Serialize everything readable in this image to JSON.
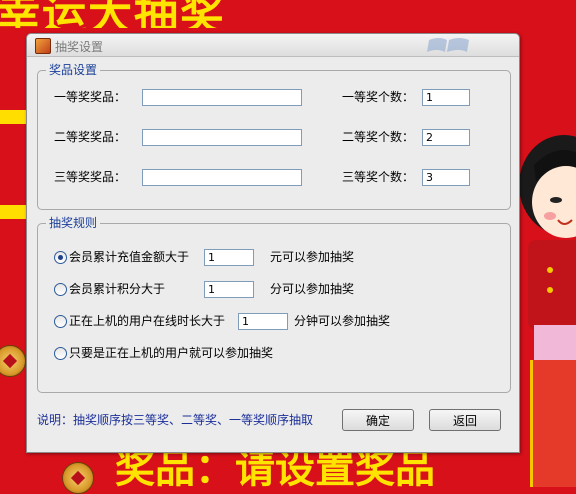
{
  "background": {
    "top_banner_text": "幸运大抽奖",
    "bottom_banner_text": "奖品：请设置奖品"
  },
  "dialog": {
    "title": "抽奖设置",
    "prizes_group": {
      "title": "奖品设置",
      "rows": [
        {
          "prize_label": "一等奖奖品：",
          "prize_value": "",
          "count_label": "一等奖个数：",
          "count_value": "1"
        },
        {
          "prize_label": "二等奖奖品：",
          "prize_value": "",
          "count_label": "二等奖个数：",
          "count_value": "2"
        },
        {
          "prize_label": "三等奖奖品：",
          "prize_value": "",
          "count_label": "三等奖个数：",
          "count_value": "3"
        }
      ]
    },
    "rules_group": {
      "title": "抽奖规则",
      "options": [
        {
          "label": "会员累计充值金额大于",
          "value": "1",
          "suffix": "元可以参加抽奖",
          "checked": true
        },
        {
          "label": "会员累计积分大于",
          "value": "1",
          "suffix": "分可以参加抽奖",
          "checked": false
        },
        {
          "label": "正在上机的用户在线时长大于",
          "value": "1",
          "suffix": "分钟可以参加抽奖",
          "checked": false
        },
        {
          "label": "只要是正在上机的用户就可以参加抽奖",
          "checked": false
        }
      ]
    },
    "note": "说明：抽奖顺序按三等奖、二等奖、一等奖顺序抽取",
    "ok_label": "确定",
    "back_label": "返回"
  }
}
